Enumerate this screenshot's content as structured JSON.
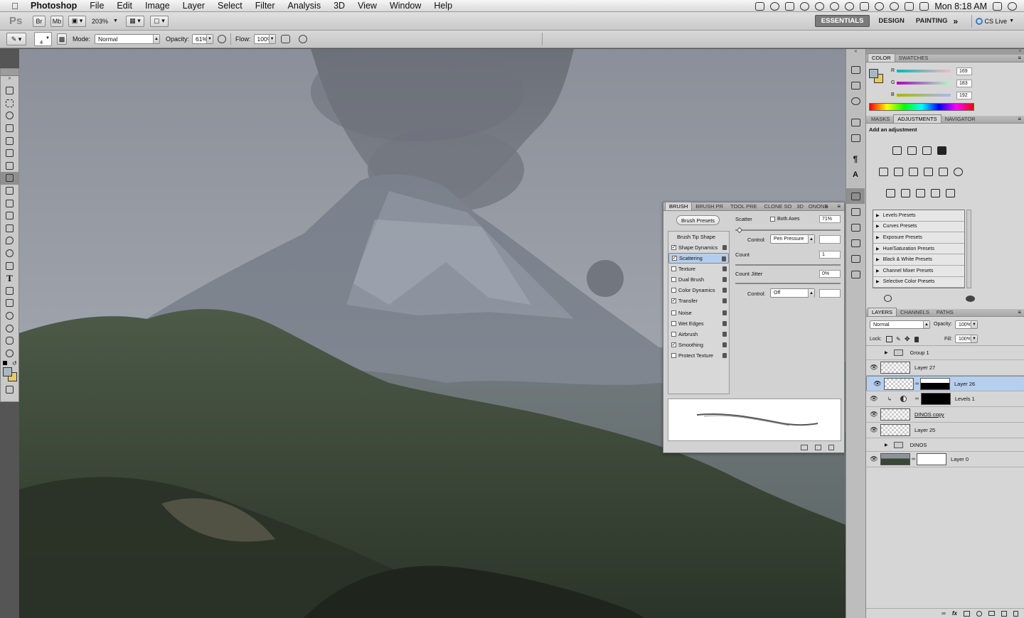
{
  "menubar": {
    "app": "Photoshop",
    "items": [
      "File",
      "Edit",
      "Image",
      "Layer",
      "Select",
      "Filter",
      "Analysis",
      "3D",
      "View",
      "Window",
      "Help"
    ],
    "clock": "Mon 8:18 AM"
  },
  "appbar": {
    "logo": "Ps",
    "zoom": "203%",
    "workspaces": [
      "ESSENTIALS",
      "DESIGN",
      "PAINTING"
    ],
    "active_workspace": "ESSENTIALS",
    "cslive": "CS Live"
  },
  "options": {
    "brush_size": "4",
    "mode_label": "Mode:",
    "mode_value": "Normal",
    "opacity_label": "Opacity:",
    "opacity_value": "61%",
    "flow_label": "Flow:",
    "flow_value": "100%"
  },
  "color_panel": {
    "tabs": [
      "COLOR",
      "SWATCHES"
    ],
    "r_label": "R",
    "r": "169",
    "g_label": "G",
    "g": "183",
    "b_label": "B",
    "b": "192",
    "foreground": "#a9b7c0"
  },
  "adjustments_panel": {
    "tabs": [
      "MASKS",
      "ADJUSTMENTS",
      "NAVIGATOR"
    ],
    "title": "Add an adjustment",
    "presets": [
      "Levels Presets",
      "Curves Presets",
      "Exposure Presets",
      "Hue/Saturation Presets",
      "Black & White Presets",
      "Channel Mixer Presets",
      "Selective Color Presets"
    ]
  },
  "layers_panel": {
    "tabs": [
      "LAYERS",
      "CHANNELS",
      "PATHS"
    ],
    "blend_mode": "Normal",
    "opacity_label": "Opacity:",
    "opacity": "100%",
    "lock_label": "Lock:",
    "fill_label": "Fill:",
    "fill": "100%",
    "layers": [
      "Group 1",
      "Layer 27",
      "Layer 26",
      "Levels 1",
      "DINOS copy",
      "Layer 25",
      "DINOS",
      "Layer 0"
    ]
  },
  "brush_panel": {
    "tabs": [
      "BRUSH",
      "BRUSH PR",
      "TOOL PRE",
      "CLONE SO",
      "3D",
      "ONONE"
    ],
    "presets_button": "Brush Presets",
    "tip_shape": "Brush Tip Shape",
    "options": [
      "Shape Dynamics",
      "Scattering",
      "Texture",
      "Dual Brush",
      "Color Dynamics",
      "Transfer",
      "Noise",
      "Wet Edges",
      "Airbrush",
      "Smoothing",
      "Protect Texture"
    ],
    "checked": [
      true,
      true,
      false,
      false,
      false,
      true,
      false,
      false,
      false,
      true,
      false
    ],
    "scatter_label": "Scatter",
    "both_axes": "Both Axes",
    "scatter_value": "71%",
    "control_label": "Control:",
    "control_value": "Pen Pressure",
    "count_label": "Count",
    "count_value": "1",
    "count_jitter_label": "Count Jitter",
    "count_jitter_value": "0%",
    "control2_value": "Off"
  }
}
